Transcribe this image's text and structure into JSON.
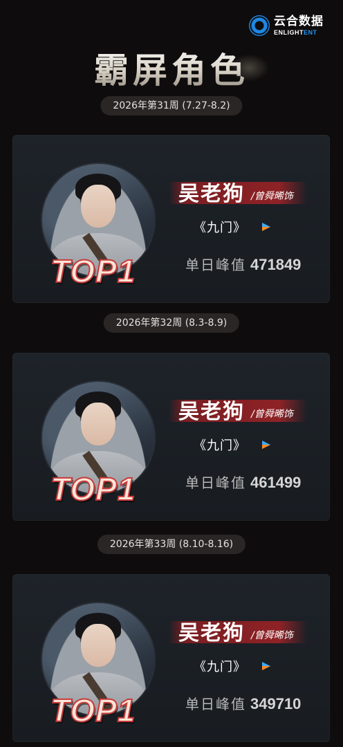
{
  "header": {
    "logo_cn": "云合数据",
    "logo_en_main": "ENLIGHT",
    "logo_en_accent": "ENT",
    "title": "霸屏角色"
  },
  "weeks": [
    {
      "label": "2026年第31周 (7.27-8.2)",
      "rank_badge": "TOP1",
      "character": "吴老狗",
      "actor_credit": "/曾舜晞饰",
      "drama": "《九门》",
      "peak_label": "单日峰值",
      "peak_value": "471849"
    },
    {
      "label": "2026年第32周 (8.3-8.9)",
      "rank_badge": "TOP1",
      "character": "吴老狗",
      "actor_credit": "/曾舜晞饰",
      "drama": "《九门》",
      "peak_label": "单日峰值",
      "peak_value": "461499"
    },
    {
      "label": "2026年第33周 (8.10-8.16)",
      "rank_badge": "TOP1",
      "character": "吴老狗",
      "actor_credit": "/曾舜晞饰",
      "drama": "《九门》",
      "peak_label": "单日峰值",
      "peak_value": "349710"
    }
  ],
  "colors": {
    "background": "#0e0c0c",
    "card": "#1c2026",
    "ribbon": "#8e2226",
    "brand_blue": "#2196f3",
    "play_icon_blue": "#3fa9f5",
    "play_icon_orange": "#ff8a1f"
  }
}
